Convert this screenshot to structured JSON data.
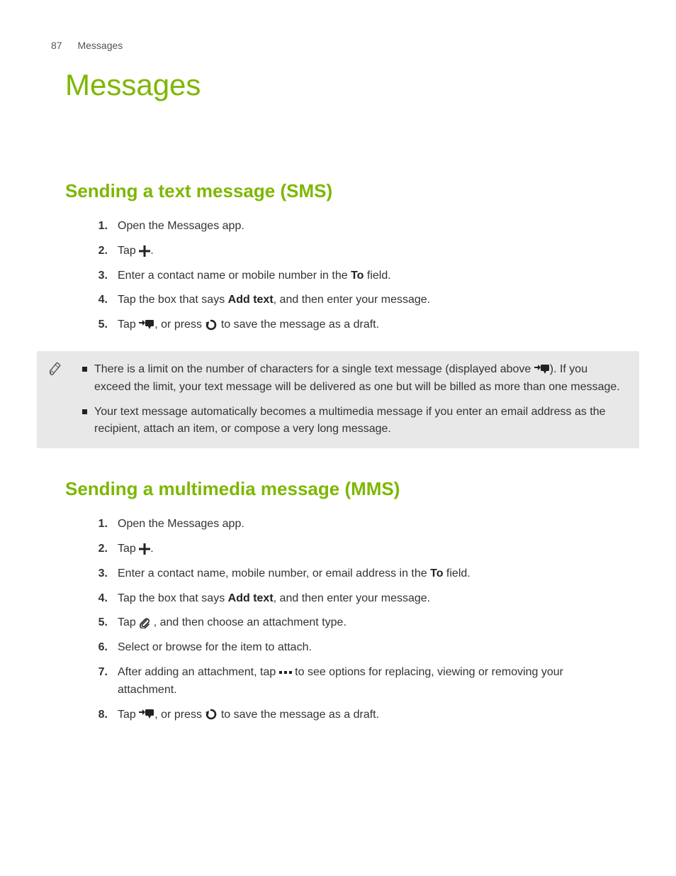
{
  "header": {
    "page_number": "87",
    "section": "Messages"
  },
  "title": "Messages",
  "sms": {
    "heading": "Sending a text message (SMS)",
    "steps": {
      "s1": "Open the Messages app.",
      "s2a": "Tap ",
      "s2b": ".",
      "s3a": "Enter a contact name or mobile number in the ",
      "s3to": "To",
      "s3b": " field.",
      "s4a": "Tap the box that says ",
      "s4add": "Add text",
      "s4b": ", and then enter your message.",
      "s5a": "Tap ",
      "s5b": ", or press ",
      "s5c": " to save the message as a draft."
    },
    "notes": {
      "n1a": "There is a limit on the number of characters for a single text message (displayed above ",
      "n1b": "). If you exceed the limit, your text message will be delivered as one but will be billed as more than one message.",
      "n2": "Your text message automatically becomes a multimedia message if you enter an email address as the recipient, attach an item, or compose a very long message."
    }
  },
  "mms": {
    "heading": "Sending a multimedia message (MMS)",
    "steps": {
      "s1": "Open the Messages app.",
      "s2a": "Tap ",
      "s2b": ".",
      "s3a": "Enter a contact name, mobile number, or email address in the ",
      "s3to": "To",
      "s3b": " field.",
      "s4a": "Tap the box that says ",
      "s4add": "Add text",
      "s4b": ", and then enter your message.",
      "s5a": "Tap ",
      "s5b": " , and then choose an attachment type.",
      "s6": "Select or browse for the item to attach.",
      "s7a": "After adding an attachment, tap ",
      "s7b": " to see options for replacing, viewing or removing your attachment.",
      "s8a": "Tap ",
      "s8b": ", or press ",
      "s8c": " to save the message as a draft."
    }
  },
  "nums": {
    "1": "1.",
    "2": "2.",
    "3": "3.",
    "4": "4.",
    "5": "5.",
    "6": "6.",
    "7": "7.",
    "8": "8."
  }
}
